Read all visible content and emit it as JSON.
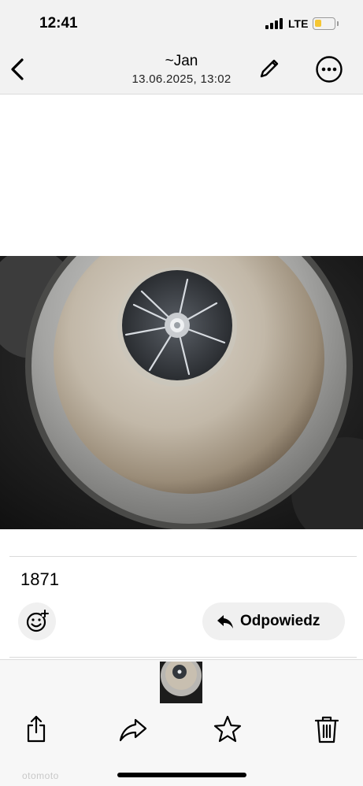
{
  "status_bar": {
    "time": "12:41",
    "network": "LTE",
    "battery_level": 0.35,
    "battery_color": "#f5c633"
  },
  "header": {
    "back_icon": "chevron-left-icon",
    "title": "~Jan",
    "subtitle": "13.06.2025, 13:02",
    "edit_icon": "pencil-icon",
    "more_icon": "ellipsis-circle-icon"
  },
  "photo": {
    "subject": "turbocharger-compressor-wheel-photo"
  },
  "message": {
    "caption": "1871",
    "reaction_icon": "smiley-add-icon",
    "reply_label": "Odpowiedz",
    "reply_icon": "reply-arrow-icon"
  },
  "toolbar": {
    "items": [
      "share-icon",
      "forward-icon",
      "star-icon",
      "trash-icon"
    ]
  },
  "watermark": "otomoto"
}
